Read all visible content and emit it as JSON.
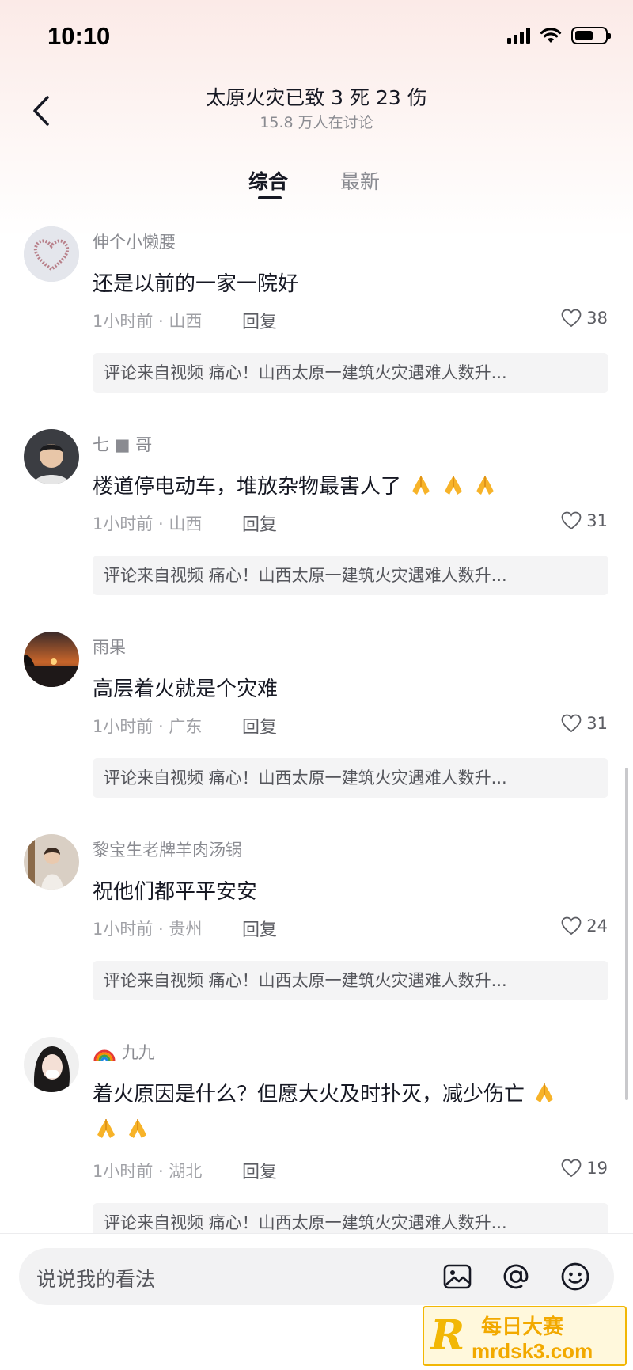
{
  "status_bar": {
    "time": "10:10"
  },
  "header": {
    "title": "太原火灾已致 3 死 23 伤",
    "subtitle": "15.8 万人在讨论"
  },
  "tabs": [
    {
      "label": "综合",
      "active": true
    },
    {
      "label": "最新",
      "active": false
    }
  ],
  "comments": [
    {
      "username": "伸个小懒腰",
      "text": "还是以前的一家一院好",
      "meta": "1小时前 · 山西",
      "reply": "回复",
      "likes": "38",
      "source": "评论来自视频 痛心！山西太原一建筑火灾遇难人数升..."
    },
    {
      "username": "七 ■ 哥",
      "text": "楼道停电动车，堆放杂物最害人了",
      "meta": "1小时前 · 山西",
      "reply": "回复",
      "likes": "31",
      "source": "评论来自视频 痛心！山西太原一建筑火灾遇难人数升..."
    },
    {
      "username": "雨果",
      "text": "高层着火就是个灾难",
      "meta": "1小时前 · 广东",
      "reply": "回复",
      "likes": "31",
      "source": "评论来自视频 痛心！山西太原一建筑火灾遇难人数升..."
    },
    {
      "username": "黎宝生老牌羊肉汤锅",
      "text": "祝他们都平平安安",
      "meta": "1小时前 · 贵州",
      "reply": "回复",
      "likes": "24",
      "source": "评论来自视频 痛心！山西太原一建筑火灾遇难人数升..."
    },
    {
      "username": "九九",
      "text": "着火原因是什么？但愿大火及时扑灭，减少伤亡",
      "meta": "1小时前 · 湖北",
      "reply": "回复",
      "likes": "19",
      "source": "评论来自视频 痛心！山西太原一建筑火灾遇难人数升..."
    }
  ],
  "input_bar": {
    "placeholder": "说说我的看法"
  },
  "watermark": {
    "title": "每日大赛",
    "url": "mrdsk3.com"
  },
  "colors": {
    "text_primary": "#161823",
    "text_secondary": "#8a8b91",
    "source_bg": "#f4f4f5",
    "watermark": "#f2b705"
  }
}
